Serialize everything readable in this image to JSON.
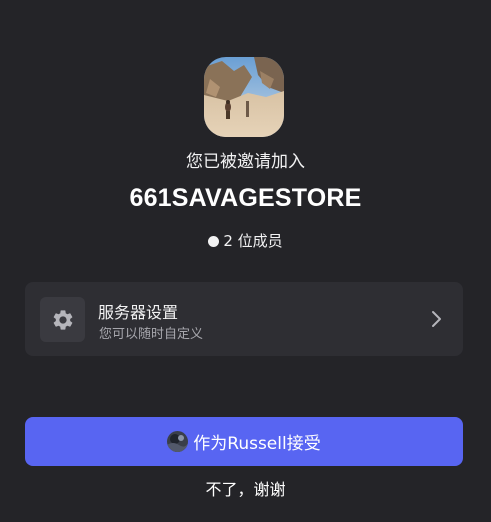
{
  "invite": {
    "invited_text": "您已被邀请加入",
    "server_name": "661SAVAGESTORE",
    "member_count": "2 位成员"
  },
  "settings_card": {
    "title": "服务器设置",
    "subtitle": "您可以随时自定义",
    "icon": "gear-icon",
    "chevron": "chevron-right-icon"
  },
  "actions": {
    "accept_label": "作为Russell接受",
    "decline_label": "不了，谢谢"
  },
  "colors": {
    "background": "#242428",
    "card": "#2e2e33",
    "accent": "#5865f2"
  }
}
